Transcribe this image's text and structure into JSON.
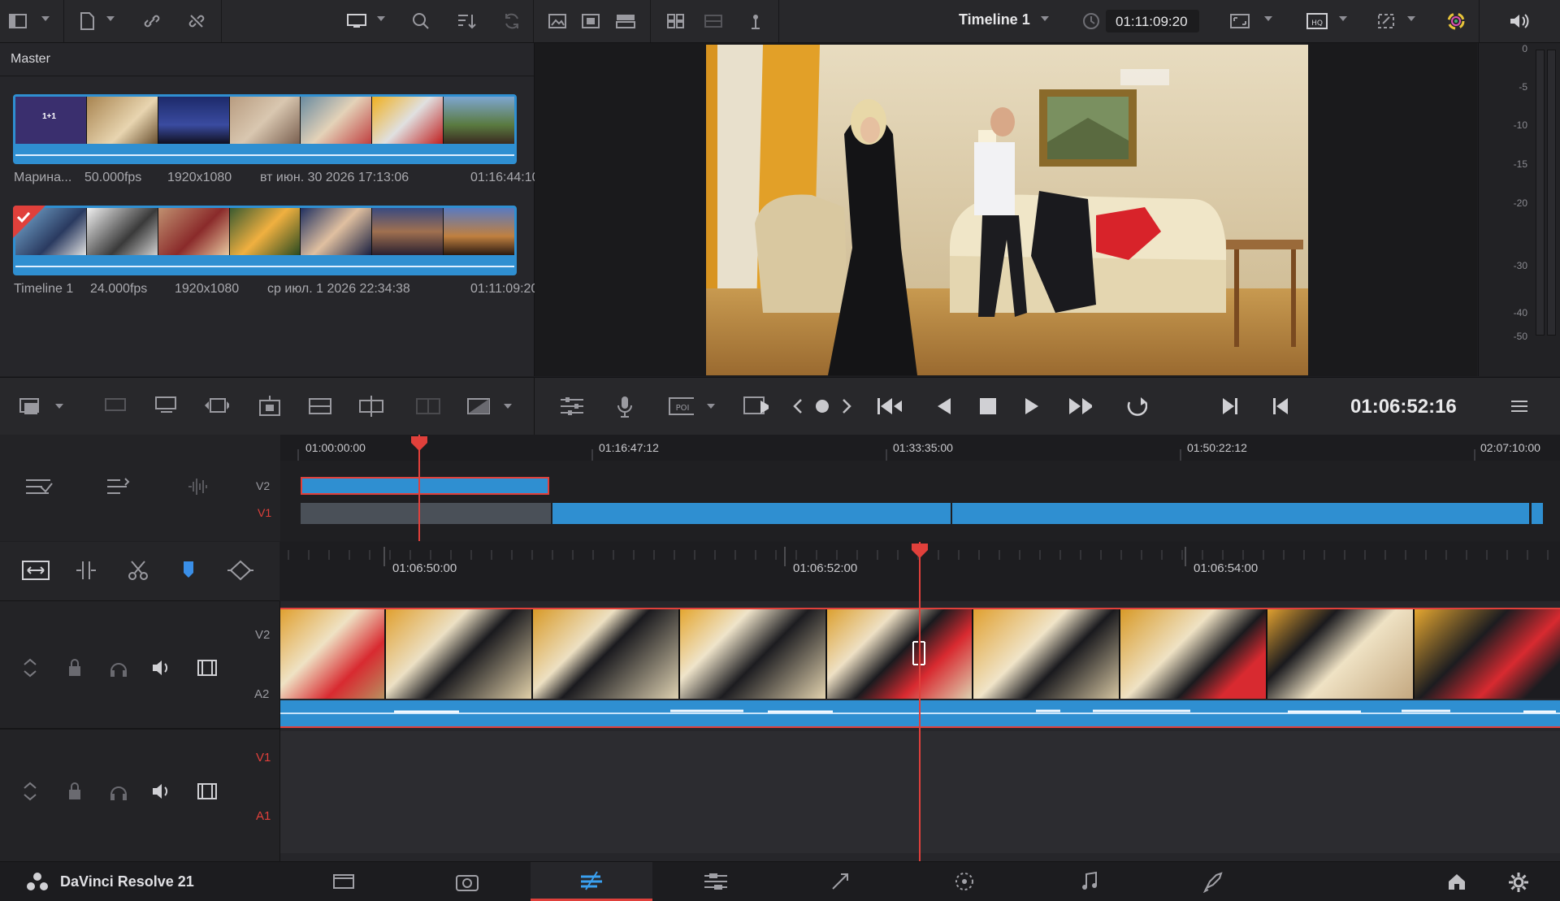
{
  "toolbar": {
    "timeline_name": "Timeline 1",
    "timecode": "01:11:09:20"
  },
  "media_pool": {
    "title": "Master",
    "clips": [
      {
        "name": "Марина...",
        "fps": "50.000fps",
        "resolution": "1920x1080",
        "date": "вт июн. 30 2026 17:13:06",
        "duration": "01:16:44:10"
      },
      {
        "name": "Timeline 1",
        "fps": "24.000fps",
        "resolution": "1920x1080",
        "date": "ср июл. 1 2026 22:34:38",
        "duration": "01:11:09:20"
      }
    ]
  },
  "meter": {
    "ticks": [
      "0",
      "-5",
      "-10",
      "-15",
      "-20",
      "-30",
      "-40",
      "-50"
    ]
  },
  "transport": {
    "current_timecode": "01:06:52:16"
  },
  "upper_timeline": {
    "ruler": [
      "01:00:00:00",
      "01:16:47:12",
      "01:33:35:00",
      "01:50:22:12",
      "02:07:10:00"
    ],
    "tracks": [
      "V2",
      "V1"
    ]
  },
  "lower_timeline": {
    "ruler": [
      "01:06:50:00",
      "01:06:52:00",
      "01:06:54:00"
    ],
    "tracks": {
      "v2": "V2",
      "a2": "A2",
      "v1": "V1",
      "a1": "A1"
    }
  },
  "bottom_bar": {
    "app_name": "DaVinci Resolve 21",
    "active_page": "cut"
  },
  "colors": {
    "accent": "#2f8fd1",
    "playhead": "#e0403b",
    "background": "#1e1e21"
  }
}
